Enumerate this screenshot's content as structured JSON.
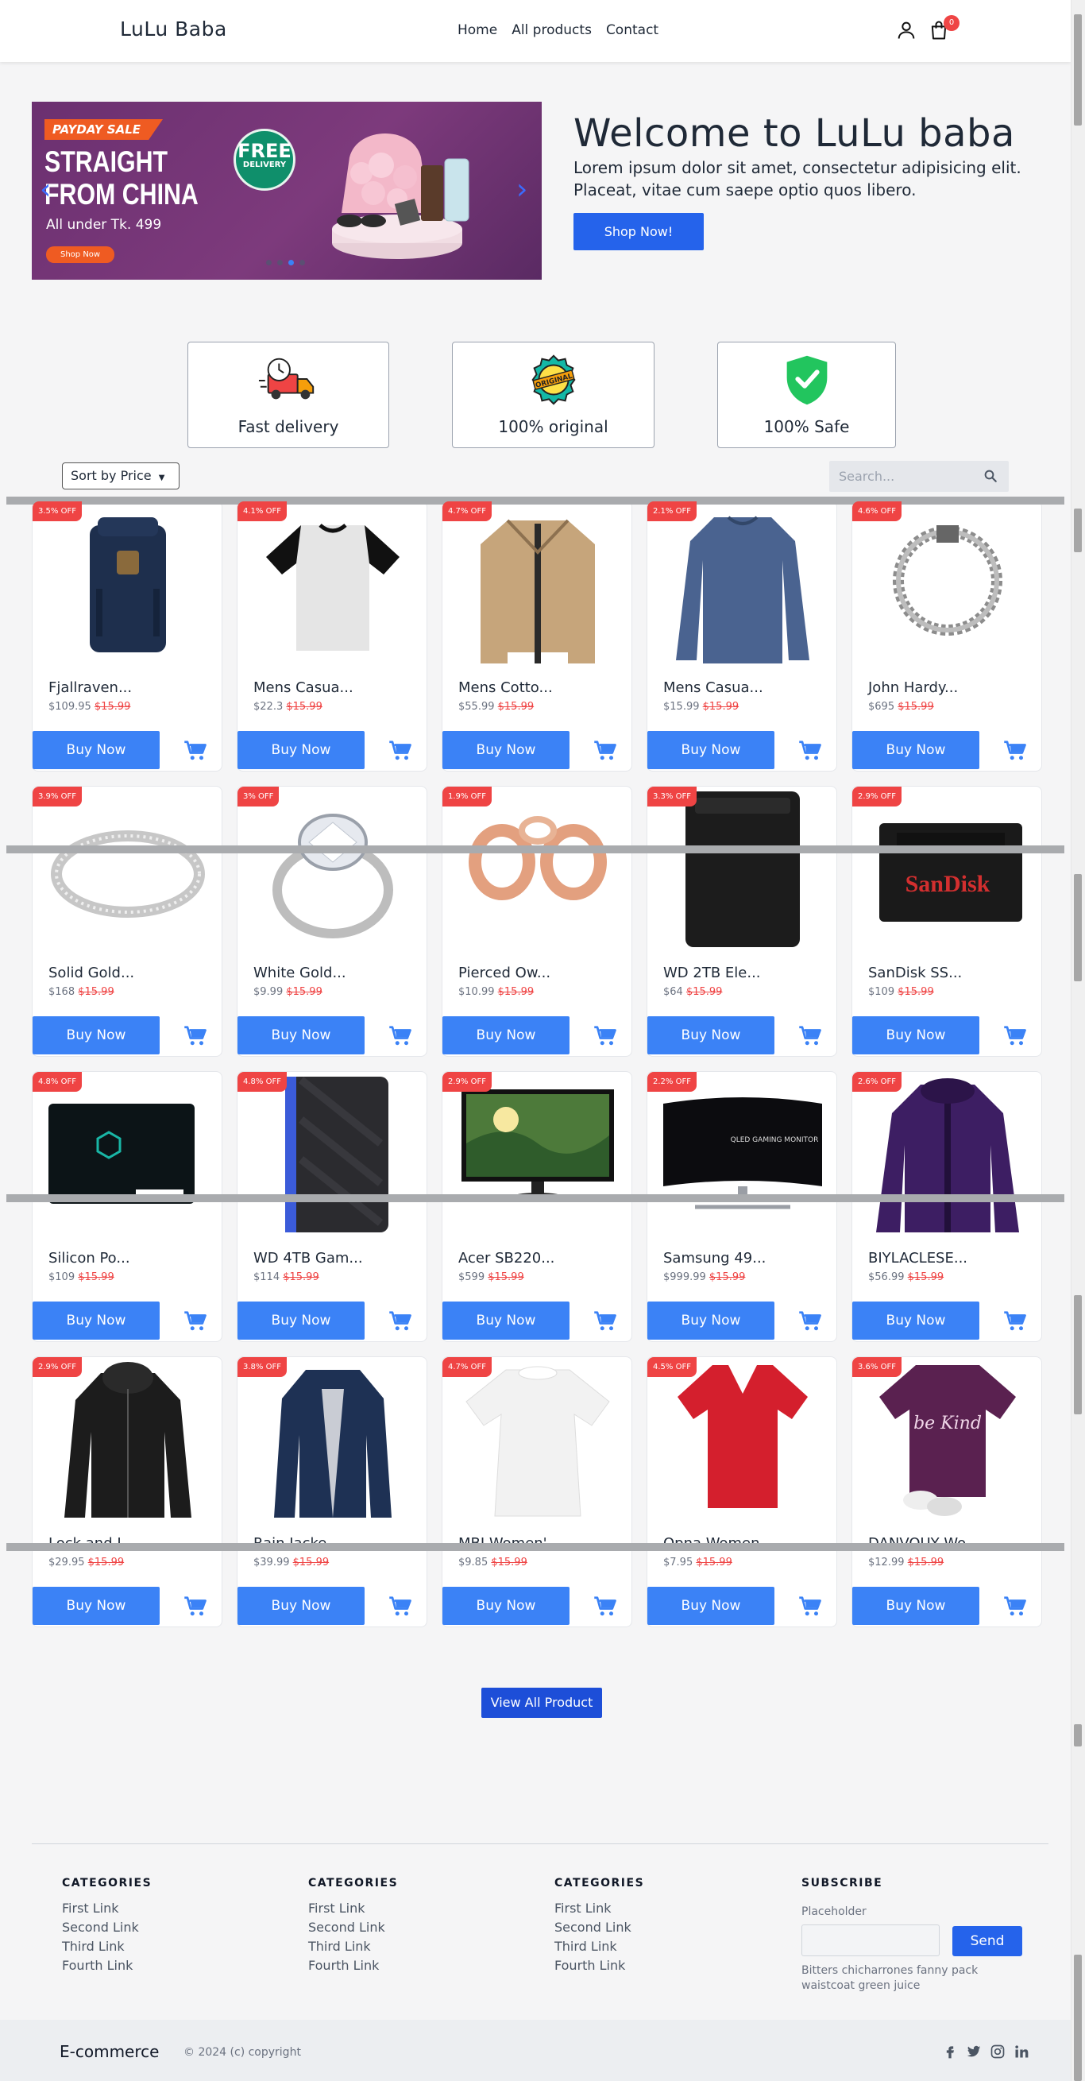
{
  "header": {
    "logo": "LuLu Baba",
    "nav": [
      "Home",
      "All products",
      "Contact"
    ],
    "cart_count": "0"
  },
  "hero": {
    "banner": {
      "tag": "PAYDAY SALE",
      "headline_1": "STRAIGHT",
      "headline_2": "FROM CHINA",
      "subtext": "All under Tk. 499",
      "shop_label": "Shop Now",
      "free_1": "FREE",
      "free_2": "DELIVERY"
    },
    "title": "Welcome to LuLu baba",
    "text": "Lorem ipsum dolor sit amet, consectetur adipisicing elit. Placeat, vitae cum saepe optio quos libero.",
    "button": "Shop Now!"
  },
  "features": [
    {
      "label": "Fast delivery",
      "icon": "delivery-truck-icon"
    },
    {
      "label": "100% original",
      "icon": "original-badge-icon",
      "badge_text": "ORIGINAL"
    },
    {
      "label": "100% Safe",
      "icon": "shield-check-icon"
    }
  ],
  "toolbar": {
    "sort_label": "Sort by Price",
    "search_placeholder": "Search..."
  },
  "products": [
    {
      "name": "Fjallraven...",
      "price": "$109.95",
      "old_price": "$15.99",
      "discount": "3.5% OFF",
      "img": "backpack"
    },
    {
      "name": "Mens Casua...",
      "price": "$22.3",
      "old_price": "$15.99",
      "discount": "4.1% OFF",
      "img": "raglan-tee"
    },
    {
      "name": "Mens Cotto...",
      "price": "$55.99",
      "old_price": "$15.99",
      "discount": "4.7% OFF",
      "img": "jacket-tan"
    },
    {
      "name": "Mens Casua...",
      "price": "$15.99",
      "old_price": "$15.99",
      "discount": "2.1% OFF",
      "img": "longsleeve-blue"
    },
    {
      "name": "John Hardy...",
      "price": "$695",
      "old_price": "$15.99",
      "discount": "4.6% OFF",
      "img": "bracelet"
    },
    {
      "name": "Solid Gold...",
      "price": "$168",
      "old_price": "$15.99",
      "discount": "3.9% OFF",
      "img": "ring-band"
    },
    {
      "name": "White Gold...",
      "price": "$9.99",
      "old_price": "$15.99",
      "discount": "3% OFF",
      "img": "ring-diamond"
    },
    {
      "name": "Pierced Ow...",
      "price": "$10.99",
      "old_price": "$15.99",
      "discount": "1.9% OFF",
      "img": "plugs"
    },
    {
      "name": "WD 2TB Ele...",
      "price": "$64",
      "old_price": "$15.99",
      "discount": "3.3% OFF",
      "img": "hdd-black"
    },
    {
      "name": "SanDisk SS...",
      "price": "$109",
      "old_price": "$15.99",
      "discount": "2.9% OFF",
      "img": "ssd-sandisk",
      "brand": "SanDisk"
    },
    {
      "name": "Silicon Po...",
      "price": "$109",
      "old_price": "$15.99",
      "discount": "4.8% OFF",
      "img": "ssd-sp"
    },
    {
      "name": "WD 4TB Gam...",
      "price": "$114",
      "old_price": "$15.99",
      "discount": "4.8% OFF",
      "img": "hdd-gaming"
    },
    {
      "name": "Acer SB220...",
      "price": "$599",
      "old_price": "$15.99",
      "discount": "2.9% OFF",
      "img": "monitor"
    },
    {
      "name": "Samsung 49...",
      "price": "$999.99",
      "old_price": "$15.99",
      "discount": "2.2% OFF",
      "img": "monitor-curved",
      "screen_text": "QLED GAMING MONITOR"
    },
    {
      "name": "BIYLACLESE...",
      "price": "$56.99",
      "old_price": "$15.99",
      "discount": "2.6% OFF",
      "img": "jacket-purple"
    },
    {
      "name": "Lock and L...",
      "price": "$29.95",
      "old_price": "$15.99",
      "discount": "2.9% OFF",
      "img": "leather-jacket"
    },
    {
      "name": "Rain Jacke...",
      "price": "$39.99",
      "old_price": "$15.99",
      "discount": "3.8% OFF",
      "img": "raincoat"
    },
    {
      "name": "MBJ Women'...",
      "price": "$9.85",
      "old_price": "$15.99",
      "discount": "4.7% OFF",
      "img": "white-tee"
    },
    {
      "name": "Opna Women...",
      "price": "$7.95",
      "old_price": "$15.99",
      "discount": "4.5% OFF",
      "img": "red-tee"
    },
    {
      "name": "DANVOUY Wo...",
      "price": "$12.99",
      "old_price": "$15.99",
      "discount": "3.6% OFF",
      "img": "purple-tee",
      "print_text": "be Kind"
    }
  ],
  "buy_label": "Buy Now",
  "view_all": "View All Product",
  "footer": {
    "columns": [
      {
        "title": "CATEGORIES",
        "links": [
          "First Link",
          "Second Link",
          "Third Link",
          "Fourth Link"
        ]
      },
      {
        "title": "CATEGORIES",
        "links": [
          "First Link",
          "Second Link",
          "Third Link",
          "Fourth Link"
        ]
      },
      {
        "title": "CATEGORIES",
        "links": [
          "First Link",
          "Second Link",
          "Third Link",
          "Fourth Link"
        ]
      }
    ],
    "subscribe": {
      "title": "SUBSCRIBE",
      "label": "Placeholder",
      "button": "Send",
      "text": "Bitters chicharrones fanny pack waistcoat green juice"
    },
    "brand": "E-commerce",
    "copyright": "© 2024 (c) copyright",
    "social": [
      "facebook-icon",
      "twitter-icon",
      "instagram-icon",
      "linkedin-icon"
    ]
  },
  "colors": {
    "accent": "#3b82f6",
    "primary_button": "#2563eb",
    "sale_red": "#ef4444"
  }
}
